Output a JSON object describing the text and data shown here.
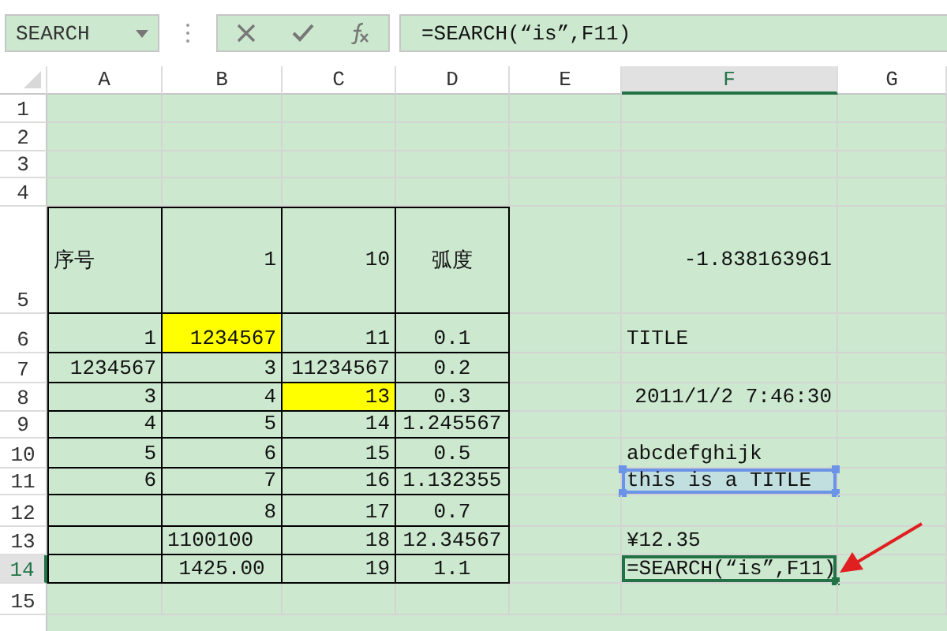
{
  "name_box": {
    "value": "SEARCH"
  },
  "formula_bar": {
    "value": "=SEARCH(“is”,F11)"
  },
  "columns": [
    {
      "label": "A",
      "selected": false
    },
    {
      "label": "B",
      "selected": false
    },
    {
      "label": "C",
      "selected": false
    },
    {
      "label": "D",
      "selected": false
    },
    {
      "label": "E",
      "selected": false
    },
    {
      "label": "F",
      "selected": true
    },
    {
      "label": "G",
      "selected": false
    }
  ],
  "rows": [
    {
      "label": "1",
      "selected": false,
      "boxed": false,
      "cells": []
    },
    {
      "label": "2",
      "selected": false,
      "boxed": false,
      "cells": []
    },
    {
      "label": "3",
      "selected": false,
      "boxed": false,
      "cells": []
    },
    {
      "label": "4",
      "selected": false,
      "boxed": false,
      "cells": []
    },
    {
      "label": "5",
      "selected": false,
      "boxed": true,
      "cells": [
        {
          "text": "序号",
          "kind": "text",
          "highlighted": false,
          "referenced": false,
          "selected": false
        },
        {
          "text": "1",
          "kind": "number",
          "highlighted": false,
          "referenced": false,
          "selected": false
        },
        {
          "text": "10",
          "kind": "number",
          "highlighted": false,
          "referenced": false,
          "selected": false
        },
        {
          "text": "弧度",
          "kind": "centered",
          "highlighted": false,
          "referenced": false,
          "selected": false
        },
        {},
        {
          "text": "-1.838163961",
          "kind": "number",
          "highlighted": false,
          "referenced": false,
          "selected": false
        },
        {}
      ]
    },
    {
      "label": "6",
      "selected": false,
      "boxed": true,
      "cells": [
        {
          "text": "1",
          "kind": "number",
          "highlighted": false,
          "referenced": false,
          "selected": false
        },
        {
          "text": "1234567",
          "kind": "number",
          "highlighted": true,
          "referenced": false,
          "selected": false
        },
        {
          "text": "11",
          "kind": "number",
          "highlighted": false,
          "referenced": false,
          "selected": false
        },
        {
          "text": "0.1",
          "kind": "centered",
          "highlighted": false,
          "referenced": false,
          "selected": false
        },
        {},
        {
          "text": "TITLE",
          "kind": "text",
          "highlighted": false,
          "referenced": false,
          "selected": false
        },
        {}
      ]
    },
    {
      "label": "7",
      "selected": false,
      "boxed": true,
      "cells": [
        {
          "text": "1234567",
          "kind": "number",
          "highlighted": false,
          "referenced": false,
          "selected": false
        },
        {
          "text": "3",
          "kind": "number",
          "highlighted": false,
          "referenced": false,
          "selected": false
        },
        {
          "text": "11234567",
          "kind": "number",
          "highlighted": false,
          "referenced": false,
          "selected": false
        },
        {
          "text": "0.2",
          "kind": "centered",
          "highlighted": false,
          "referenced": false,
          "selected": false
        },
        {},
        {},
        {}
      ]
    },
    {
      "label": "8",
      "selected": false,
      "boxed": true,
      "cells": [
        {
          "text": "3",
          "kind": "number",
          "highlighted": false,
          "referenced": false,
          "selected": false
        },
        {
          "text": "4",
          "kind": "number",
          "highlighted": false,
          "referenced": false,
          "selected": false
        },
        {
          "text": "13",
          "kind": "number",
          "highlighted": true,
          "referenced": false,
          "selected": false
        },
        {
          "text": "0.3",
          "kind": "centered",
          "highlighted": false,
          "referenced": false,
          "selected": false
        },
        {},
        {
          "text": "2011/1/2 7:46:30",
          "kind": "number",
          "highlighted": false,
          "referenced": false,
          "selected": false
        },
        {}
      ]
    },
    {
      "label": "9",
      "selected": false,
      "boxed": true,
      "cells": [
        {
          "text": "4",
          "kind": "number",
          "highlighted": false,
          "referenced": false,
          "selected": false
        },
        {
          "text": "5",
          "kind": "number",
          "highlighted": false,
          "referenced": false,
          "selected": false
        },
        {
          "text": "14",
          "kind": "number",
          "highlighted": false,
          "referenced": false,
          "selected": false
        },
        {
          "text": "1.245567",
          "kind": "centered",
          "highlighted": false,
          "referenced": false,
          "selected": false
        },
        {},
        {},
        {}
      ]
    },
    {
      "label": "10",
      "selected": false,
      "boxed": true,
      "cells": [
        {
          "text": "5",
          "kind": "number",
          "highlighted": false,
          "referenced": false,
          "selected": false
        },
        {
          "text": "6",
          "kind": "number",
          "highlighted": false,
          "referenced": false,
          "selected": false
        },
        {
          "text": "15",
          "kind": "number",
          "highlighted": false,
          "referenced": false,
          "selected": false
        },
        {
          "text": "0.5",
          "kind": "centered",
          "highlighted": false,
          "referenced": false,
          "selected": false
        },
        {},
        {
          "text": "abcdefghijk",
          "kind": "text",
          "highlighted": false,
          "referenced": false,
          "selected": false
        },
        {}
      ]
    },
    {
      "label": "11",
      "selected": false,
      "boxed": true,
      "cells": [
        {
          "text": "6",
          "kind": "number",
          "highlighted": false,
          "referenced": false,
          "selected": false
        },
        {
          "text": "7",
          "kind": "number",
          "highlighted": false,
          "referenced": false,
          "selected": false
        },
        {
          "text": "16",
          "kind": "number",
          "highlighted": false,
          "referenced": false,
          "selected": false
        },
        {
          "text": "1.132355",
          "kind": "centered",
          "highlighted": false,
          "referenced": false,
          "selected": false
        },
        {},
        {
          "text": "this is a TITLE",
          "kind": "text",
          "highlighted": false,
          "referenced": true,
          "selected": false
        },
        {}
      ]
    },
    {
      "label": "12",
      "selected": false,
      "boxed": true,
      "cells": [
        {},
        {
          "text": "8",
          "kind": "number",
          "highlighted": false,
          "referenced": false,
          "selected": false
        },
        {
          "text": "17",
          "kind": "number",
          "highlighted": false,
          "referenced": false,
          "selected": false
        },
        {
          "text": "0.7",
          "kind": "centered",
          "highlighted": false,
          "referenced": false,
          "selected": false
        },
        {},
        {},
        {}
      ]
    },
    {
      "label": "13",
      "selected": false,
      "boxed": true,
      "cells": [
        {},
        {
          "text": "1100100",
          "kind": "text",
          "highlighted": false,
          "referenced": false,
          "selected": false
        },
        {
          "text": "18",
          "kind": "number",
          "highlighted": false,
          "referenced": false,
          "selected": false
        },
        {
          "text": "12.34567",
          "kind": "centered",
          "highlighted": false,
          "referenced": false,
          "selected": false
        },
        {},
        {
          "text": "¥12.35",
          "kind": "text",
          "highlighted": false,
          "referenced": false,
          "selected": false
        },
        {}
      ]
    },
    {
      "label": "14",
      "selected": true,
      "boxed": true,
      "cells": [
        {},
        {
          "text": "1425.00",
          "kind": "centered",
          "highlighted": false,
          "referenced": false,
          "selected": false
        },
        {
          "text": "19",
          "kind": "number",
          "highlighted": false,
          "referenced": false,
          "selected": false
        },
        {
          "text": "1.1",
          "kind": "centered",
          "highlighted": false,
          "referenced": false,
          "selected": false
        },
        {},
        {
          "text": "=SEARCH(“is”,F11)",
          "kind": "text",
          "highlighted": false,
          "referenced": false,
          "selected": true
        },
        {}
      ]
    },
    {
      "label": "15",
      "selected": false,
      "boxed": false,
      "cells": []
    }
  ]
}
